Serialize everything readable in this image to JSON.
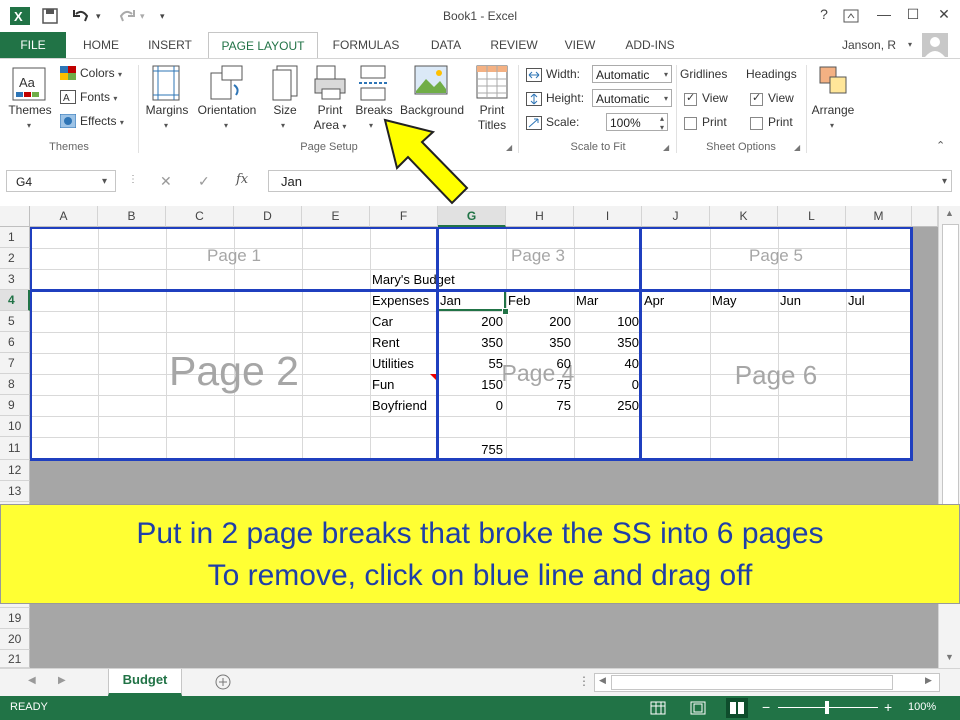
{
  "titlebar": {
    "title": "Book1 - Excel",
    "icons": [
      "excel-icon",
      "save-icon",
      "undo-icon",
      "redo-icon",
      "help-icon",
      "ribbon-display-icon",
      "minimize-icon",
      "restore-icon",
      "close-icon"
    ],
    "help": "?",
    "minimize": "—",
    "restore": "☐",
    "close": "✕"
  },
  "tabs": {
    "file": "FILE",
    "items": [
      "HOME",
      "INSERT",
      "PAGE LAYOUT",
      "FORMULAS",
      "DATA",
      "REVIEW",
      "VIEW",
      "ADD-INS"
    ],
    "user": "Janson, R"
  },
  "ribbon": {
    "themes": {
      "themes": "Themes",
      "colors": "Colors",
      "fonts": "Fonts",
      "effects": "Effects",
      "group": "Themes"
    },
    "page_setup": {
      "margins": "Margins",
      "orientation": "Orientation",
      "size": "Size",
      "print_area_1": "Print",
      "print_area_2": "Area",
      "breaks": "Breaks",
      "background": "Background",
      "print_titles_1": "Print",
      "print_titles_2": "Titles",
      "group": "Page Setup"
    },
    "scale": {
      "width_label": "Width:",
      "width_value": "Automatic",
      "height_label": "Height:",
      "height_value": "Automatic",
      "scale_label": "Scale:",
      "scale_value": "100%",
      "group": "Scale to Fit"
    },
    "sheet_options": {
      "gridlines": "Gridlines",
      "headings": "Headings",
      "view": "View",
      "print": "Print",
      "group": "Sheet Options"
    },
    "arrange": "Arrange"
  },
  "formula_bar": {
    "name_box": "G4",
    "fx": "fx",
    "content": "Jan"
  },
  "columns": [
    "A",
    "B",
    "C",
    "D",
    "E",
    "F",
    "G",
    "H",
    "I",
    "J",
    "K",
    "L",
    "M"
  ],
  "rows": [
    "1",
    "2",
    "3",
    "4",
    "5",
    "6",
    "7",
    "8",
    "9",
    "10",
    "11",
    "12",
    "13",
    "19",
    "20",
    "21"
  ],
  "cells": {
    "F3": "Mary's Budget",
    "F4": "Expenses",
    "G4": "Jan",
    "H4": "Feb",
    "I4": "Mar",
    "J4": "Apr",
    "K4": "May",
    "L4": "Jun",
    "M4": "Jul",
    "F5": "Car",
    "G5": "200",
    "H5": "200",
    "I5": "100",
    "F6": "Rent",
    "G6": "350",
    "H6": "350",
    "I6": "350",
    "F7": "Utilities",
    "G7": "55",
    "H7": "60",
    "I7": "40",
    "F8": "Fun",
    "G8": "150",
    "H8": "75",
    "I8": "0",
    "F9": "Boyfriend",
    "G9": "0",
    "H9": "75",
    "I9": "250",
    "G11": "755"
  },
  "page_labels": {
    "p1": "Page 1",
    "p2": "Page 2",
    "p3": "Page 3",
    "p4": "Page 4",
    "p5": "Page 5",
    "p6": "Page 6"
  },
  "caption": {
    "line1": "Put in 2 page breaks that broke the SS into 6 pages",
    "line2": "To remove, click on blue line and drag off"
  },
  "sheet_tab": "Budget",
  "status": {
    "ready": "READY",
    "zoom": "100%"
  },
  "colors": {
    "excel_green": "#217346",
    "caption_bg": "#ffff33",
    "caption_text": "#1f3fa8",
    "page_break_line": "#1f3fbf",
    "arrow_fill": "#ffff00"
  }
}
